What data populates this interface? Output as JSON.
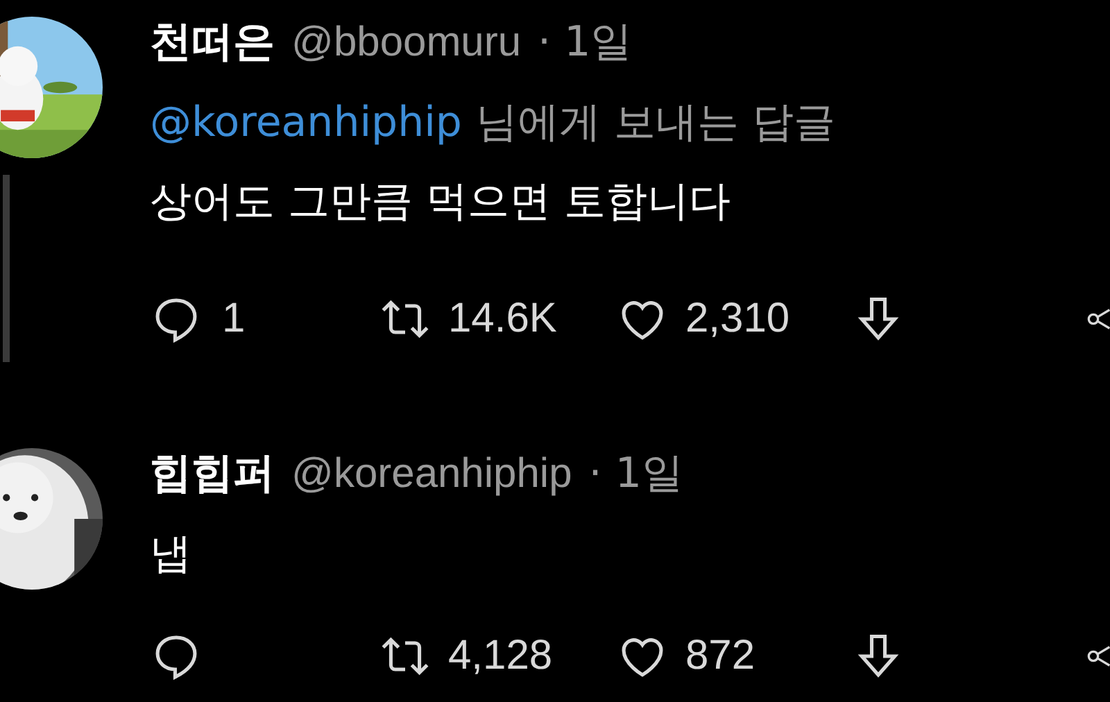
{
  "tweets": [
    {
      "name": "천떠은",
      "handle": "@bboomuru",
      "time": "· 1일",
      "reply_to": {
        "mention": "@koreanhiphip",
        "suffix": "님에게 보내는 답글"
      },
      "body": "상어도 그만큼 먹으면 토합니다",
      "thread_line": true,
      "actions": {
        "replies": "1",
        "retweets": "14.6K",
        "likes": "2,310"
      }
    },
    {
      "name": "힙힙퍼",
      "handle": "@koreanhiphip",
      "time": "· 1일",
      "body": "냅",
      "thread_line": false,
      "actions": {
        "retweets": "4,128",
        "likes": "872"
      }
    }
  ]
}
